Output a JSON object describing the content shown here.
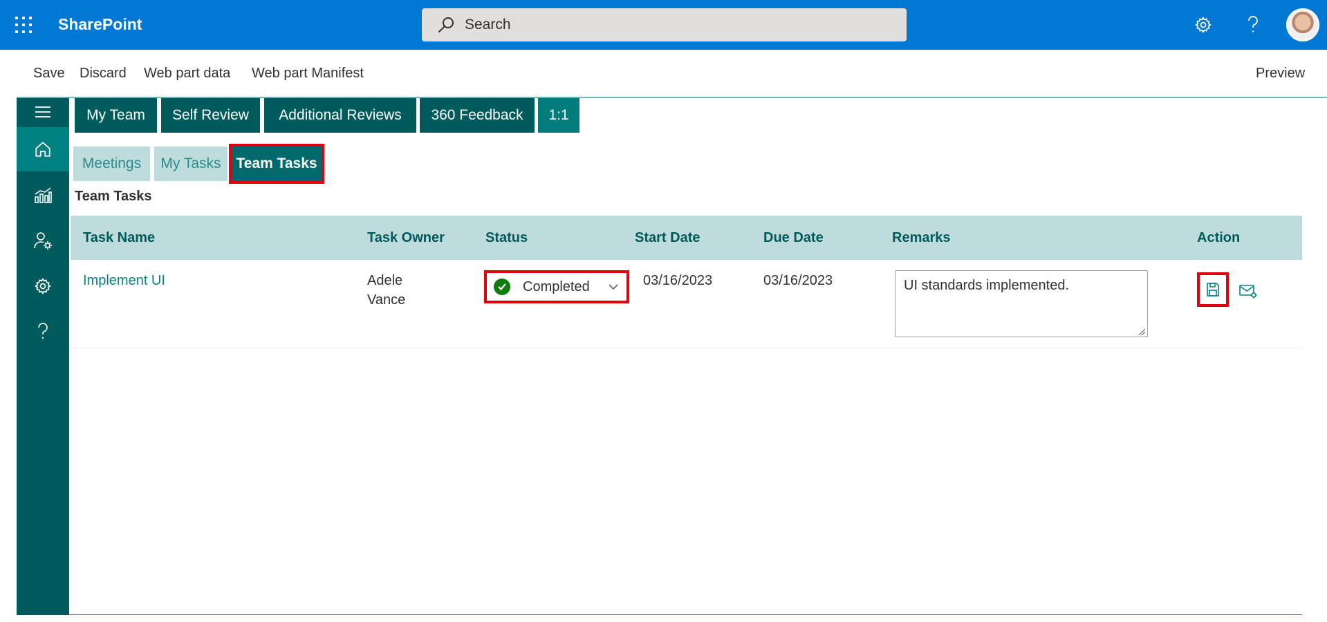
{
  "suite": {
    "brand": "SharePoint",
    "search_placeholder": "Search"
  },
  "command_bar": {
    "save": "Save",
    "discard": "Discard",
    "web_part_data": "Web part data",
    "web_part_manifest": "Web part Manifest",
    "preview": "Preview"
  },
  "primary_tabs": [
    "My Team",
    "Self Review",
    "Additional Reviews",
    "360 Feedback",
    "1:1"
  ],
  "secondary_tabs": [
    "Meetings",
    "My Tasks",
    "Team Tasks"
  ],
  "active_secondary_tab": "Team Tasks",
  "section_title": "Team Tasks",
  "table": {
    "headers": [
      "Task Name",
      "Task Owner",
      "Status",
      "Start Date",
      "Due Date",
      "Remarks",
      "Action"
    ],
    "rows": [
      {
        "task_name": "Implement UI",
        "owner_first": "Adele",
        "owner_last": "Vance",
        "status": "Completed",
        "start_date": "03/16/2023",
        "due_date": "03/16/2023",
        "remarks": "UI standards implemented."
      }
    ]
  },
  "colors": {
    "suite_blue": "#0078d4",
    "teal_dark": "#005b5d",
    "teal_light": "#bfdcdc",
    "highlight_red": "#e3000f",
    "status_green": "#107c10"
  }
}
